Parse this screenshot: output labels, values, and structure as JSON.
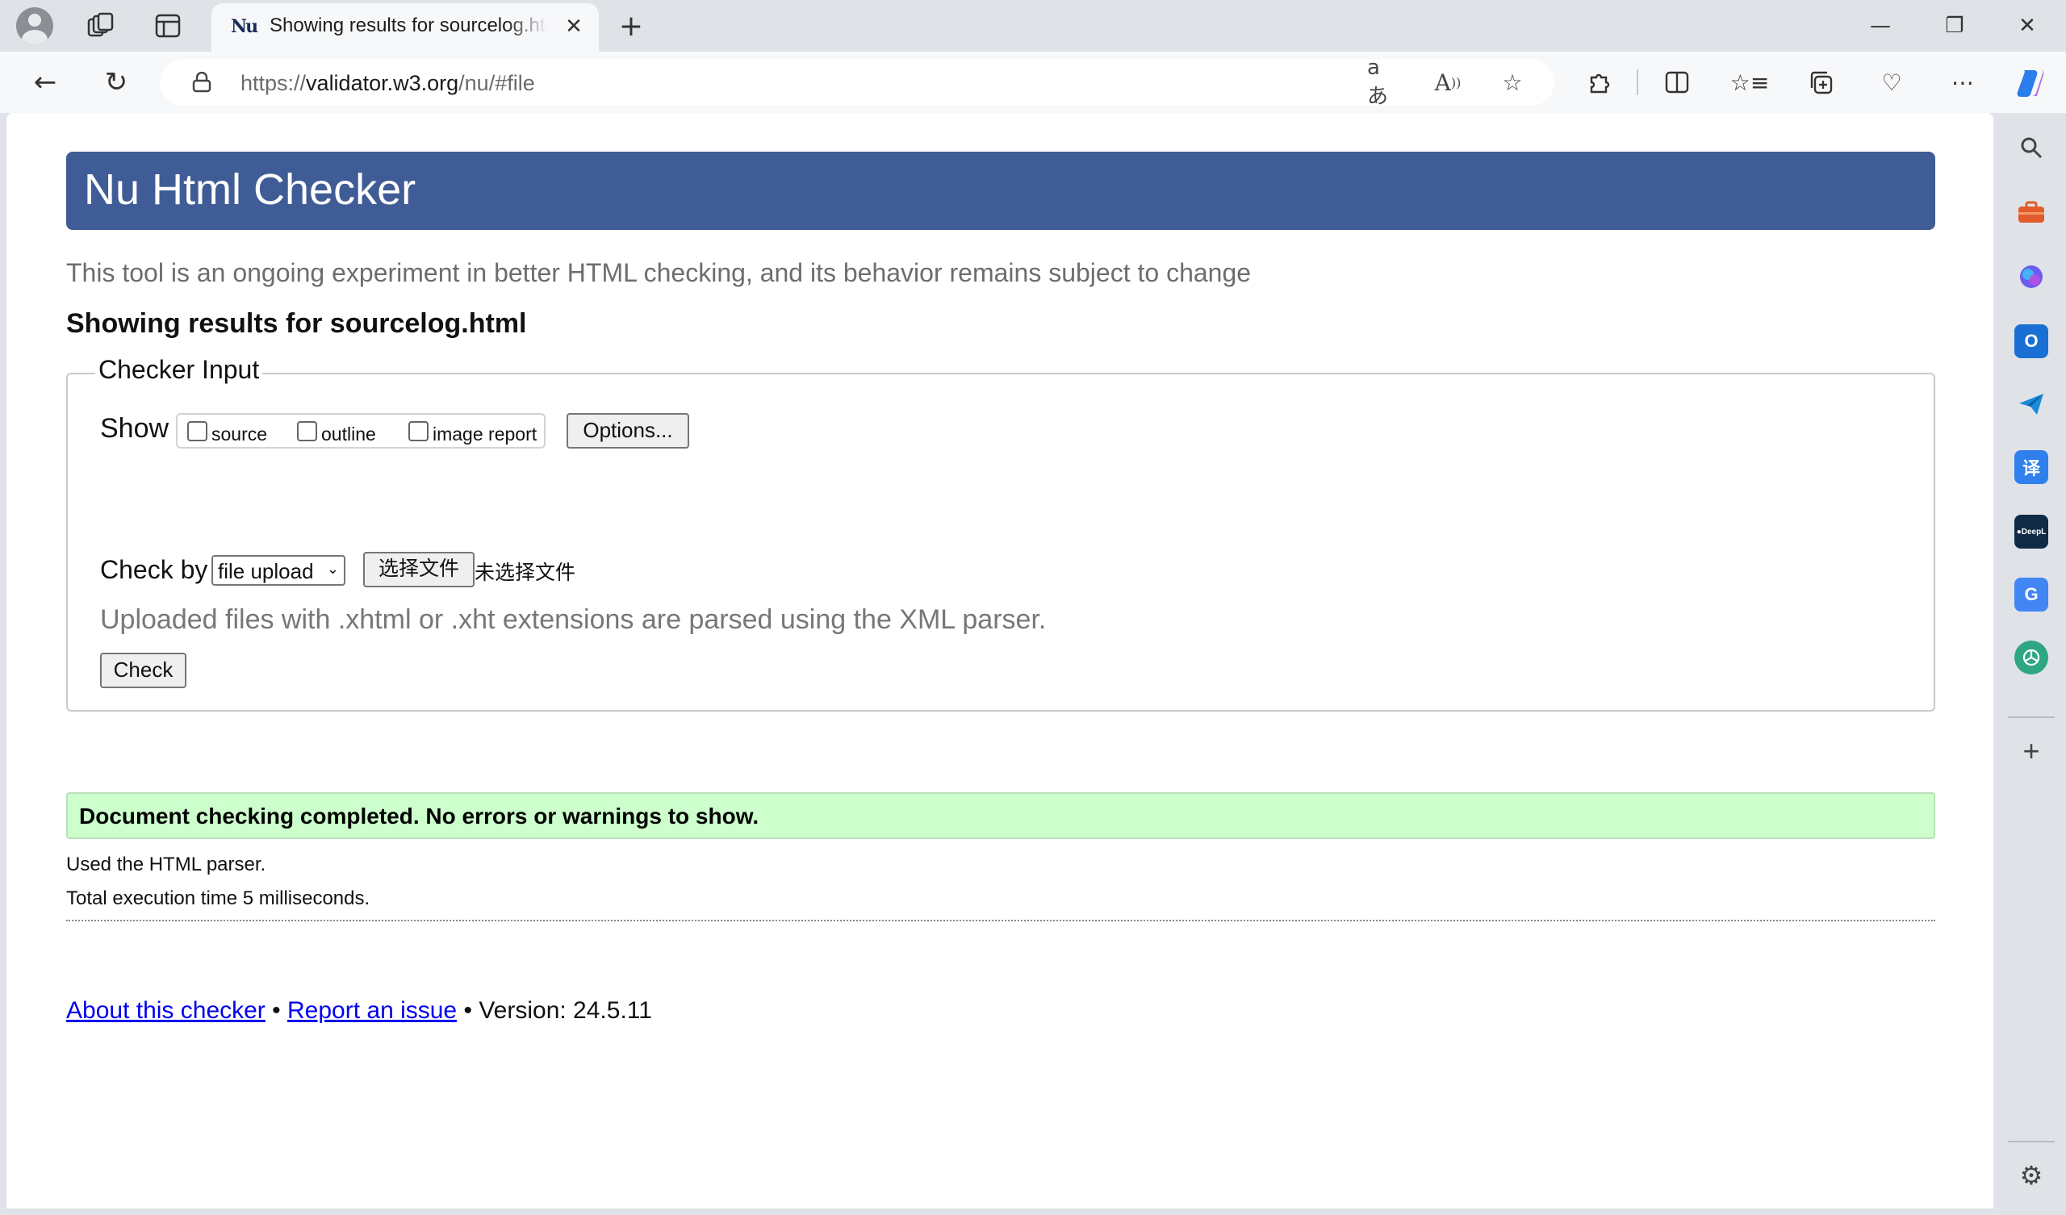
{
  "browser": {
    "tab_title": "Showing results for sourcelog.html",
    "url_prefix": "https://",
    "url_host": "validator.w3.org",
    "url_path": "/nu/#file",
    "tab_close_glyph": "✕",
    "new_tab_glyph": "+",
    "window_controls": {
      "minimize": "—",
      "restore": "❐",
      "close": "✕"
    },
    "nav": {
      "back": "←",
      "reload": "↻"
    },
    "omnibox_icons": [
      "translate-icon",
      "read-aloud-icon",
      "favorite-star-icon"
    ],
    "toolbar_icons": [
      "extensions-icon",
      "split-screen-icon",
      "favorites-icon",
      "collections-icon",
      "browser-essentials-icon",
      "more-icon",
      "copilot-icon"
    ]
  },
  "sidebar": {
    "icons": [
      {
        "name": "search-icon",
        "color": "#444444"
      },
      {
        "name": "tools-icon",
        "color": "#e25b2a"
      },
      {
        "name": "copilot-icon",
        "color": "#6a5cf0"
      },
      {
        "name": "outlook-icon",
        "color": "#1a6fd4"
      },
      {
        "name": "send-icon",
        "color": "#1b8ad8"
      },
      {
        "name": "translate-icon",
        "color": "#2f80ed"
      },
      {
        "name": "deepl-icon",
        "color": "#0f2b46"
      },
      {
        "name": "google-translate-icon",
        "color": "#4285f4"
      },
      {
        "name": "chatgpt-icon",
        "color": "#2ea583"
      },
      {
        "name": "add-icon",
        "color": "#444444"
      },
      {
        "name": "settings-icon",
        "color": "#444444"
      }
    ]
  },
  "page": {
    "title": "Nu Html Checker",
    "tagline": "This tool is an ongoing experiment in better HTML checking, and its behavior remains subject to change",
    "results_heading": "Showing results for sourcelog.html",
    "checker_input": {
      "legend": "Checker Input",
      "show_label": "Show",
      "checkboxes": {
        "source": "source",
        "outline": "outline",
        "image_report": "image report"
      },
      "options_button": "Options...",
      "check_by_label": "Check by",
      "check_by_value": "file upload",
      "choose_file_button": "选择文件",
      "no_file_text": "未选择文件",
      "hint": "Uploaded files with .xhtml or .xht extensions are parsed using the XML parser.",
      "check_button": "Check"
    },
    "result_message": "Document checking completed. No errors or warnings to show.",
    "parser_note": "Used the HTML parser.",
    "execution_time": "Total execution time 5 milliseconds.",
    "footer": {
      "about_link": "About this checker",
      "separator": "•",
      "report_link": "Report an issue",
      "version": "Version: 24.5.11"
    }
  },
  "colors": {
    "banner": "#3f5c96",
    "success_bg": "#ccffcc",
    "link": "#0000ee"
  }
}
